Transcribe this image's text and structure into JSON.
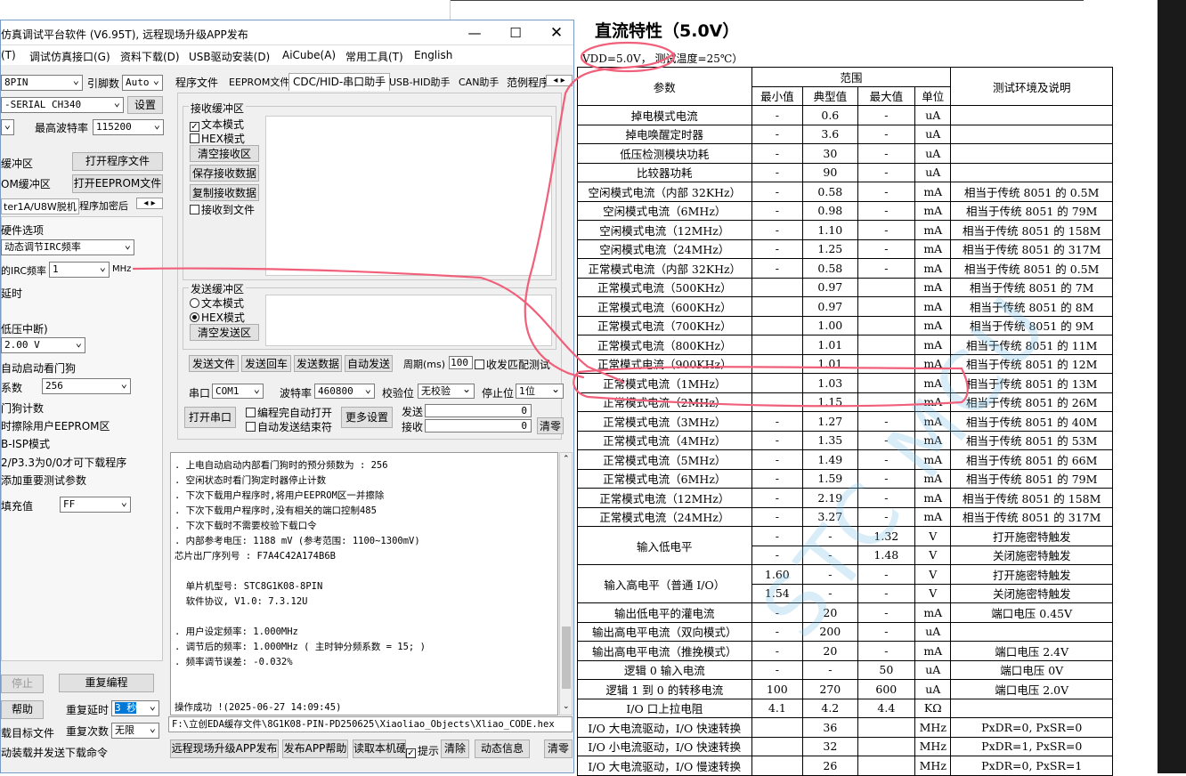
{
  "app": {
    "title": "仿真调试平台软件 (V6.95T), 远程现场升级APP发布",
    "menu": [
      "(T)",
      "调试仿真接口(G)",
      "资料下载(D)",
      "USB驱动安装(D)",
      "AiCube(A)",
      "常用工具(T)",
      "English"
    ]
  },
  "left": {
    "pin": "8PIN",
    "pin_count_label": "引脚数",
    "pin_count_value": "Auto",
    "port": "-SERIAL CH340",
    "settings": "设置",
    "max_baud_label": "最高波特率",
    "max_baud": "115200",
    "buf1": "缓冲区",
    "buf2": "OM缓冲区",
    "open_prog": "打开程序文件",
    "open_eeprom": "打开EEPROM文件",
    "tab1": "ter1A/U8W脱机",
    "tab2": "程序加密后",
    "hw_title": "硬件选项",
    "irc_mode": "动态调节IRC频率",
    "irc_label": "的IRC频率",
    "irc_value": "1",
    "mhz": "MHz",
    "delay": "延时",
    "lvd": "低压中断)",
    "voltage": "2.00 V",
    "wdt": "自动启动看门狗",
    "div_label": "系数",
    "div_value": "256",
    "wdt_count": "门狗计数",
    "erase": "时擦除用户EEPROM区",
    "isp": "B-ISP模式",
    "p32": "2/P3.3为0/0才可下载程序",
    "addparam": "添加重要测试参数",
    "fill_label": "填充值",
    "fill_value": "FF",
    "stop": "停止",
    "reprogram": "重复编程",
    "help": "帮助",
    "repeat_delay": "重复延时",
    "repeat_delay_value": "3 秒",
    "repeat_count": "重复次数",
    "repeat_count_value": "无限",
    "target": "载目标文件",
    "autodl": "动装载并发送下载命令"
  },
  "tabs": [
    "程序文件",
    "EEPROM文件",
    "CDC/HID-串口助手",
    "USB-HID助手",
    "CAN助手",
    "范例程序"
  ],
  "rx": {
    "title": "接收缓冲区",
    "text_mode": "文本模式",
    "hex_mode": "HEX模式",
    "clear": "清空接收区",
    "save": "保存接收数据",
    "copy": "复制接收数据",
    "to_file": "接收到文件"
  },
  "tx": {
    "title": "发送缓冲区",
    "text_mode": "文本模式",
    "hex_mode": "HEX模式",
    "clear": "清空发送区"
  },
  "send_row": {
    "send_file": "发送文件",
    "send_cr": "发送回车",
    "send_data": "发送数据",
    "auto_send": "自动发送",
    "period_label": "周期(ms)",
    "period": "100",
    "match": "收发匹配测试"
  },
  "serial": {
    "port_label": "串口",
    "port": "COM1",
    "baud_label": "波特率",
    "baud": "460800",
    "parity_label": "校验位",
    "parity": "无校验",
    "stop_label": "停止位",
    "stop": "1位",
    "open": "打开串口",
    "auto_open": "编程完自动打开",
    "auto_end": "自动发送结束符",
    "more": "更多设置",
    "sent_label": "发送",
    "sent": "0",
    "recv_label": "接收",
    "recv": "0",
    "clear": "清零"
  },
  "log": [
    ". 上电自动启动内部看门狗时的预分频数为 : 256",
    ". 空闲状态时看门狗定时器停止计数",
    ". 下次下载用户程序时,将用户EEPROM区一并擦除",
    ". 下次下载用户程序时,没有相关的端口控制485",
    ". 下次下载时不需要校验下载口令",
    ". 内部参考电压: 1188 mV (参考范围: 1100~1300mV)",
    "芯片出厂序列号 : F7A4C42A174B6B",
    "",
    "  单片机型号: STC8G1K08-8PIN",
    "  软件协议, V1.0: 7.3.12U",
    "",
    ". 用户设定频率: 1.000MHz",
    ". 调节后的频率: 1.000MHz ( 主时钟分频系数 = 15; )",
    ". 频率调节误差: -0.032%",
    "",
    "",
    "操作成功 !(2025-06-27 14:09:45)"
  ],
  "path": "F:\\立创EDA缓存文件\\8G1K08-PIN-PD250625\\Xiaoliao_Objects\\Xliao_CODE.hex",
  "bottom": {
    "publish": "远程现场升级APP发布",
    "help": "发布APP帮助",
    "read": "读取本机硬",
    "hint": "提示",
    "clear": "清除",
    "dyn": "动态信息",
    "zero": "清零"
  },
  "doc": {
    "title": "直流特性（5.0V）",
    "cond_vdd": "VDD=5.0V，",
    "cond_temp": "测试温度=25℃）",
    "head": {
      "param": "参数",
      "range": "范围",
      "min": "最小值",
      "typ": "典型值",
      "max": "最大值",
      "unit": "单位",
      "env": "测试环境及说明"
    },
    "rows": [
      [
        "掉电模式电流",
        "-",
        "0.6",
        "-",
        "uA",
        ""
      ],
      [
        "掉电唤醒定时器",
        "-",
        "3.6",
        "-",
        "uA",
        ""
      ],
      [
        "低压检测模块功耗",
        "-",
        "30",
        "-",
        "uA",
        ""
      ],
      [
        "比较器功耗",
        "-",
        "90",
        "-",
        "uA",
        ""
      ],
      [
        "空闲模式电流（内部 32KHz）",
        "-",
        "0.58",
        "-",
        "mA",
        "相当于传统 8051 的 0.5M"
      ],
      [
        "空闲模式电流（6MHz）",
        "-",
        "0.98",
        "-",
        "mA",
        "相当于传统 8051 的 79M"
      ],
      [
        "空闲模式电流（12MHz）",
        "-",
        "1.10",
        "-",
        "mA",
        "相当于传统 8051 的 158M"
      ],
      [
        "空闲模式电流（24MHz）",
        "-",
        "1.25",
        "-",
        "mA",
        "相当于传统 8051 的 317M"
      ],
      [
        "正常模式电流（内部 32KHz）",
        "-",
        "0.58",
        "-",
        "mA",
        "相当于传统 8051 的 0.5M"
      ],
      [
        "正常模式电流（500KHz）",
        "",
        "0.97",
        "",
        "mA",
        "相当于传统 8051 的 7M"
      ],
      [
        "正常模式电流（600KHz）",
        "",
        "0.97",
        "",
        "mA",
        "相当于传统 8051 的 8M"
      ],
      [
        "正常模式电流（700KHz）",
        "",
        "1.00",
        "",
        "mA",
        "相当于传统 8051 的 9M"
      ],
      [
        "正常模式电流（800KHz）",
        "",
        "1.01",
        "",
        "mA",
        "相当于传统 8051 的 11M"
      ],
      [
        "正常模式电流（900KHz）",
        "",
        "1.01",
        "",
        "mA",
        "相当于传统 8051 的 12M"
      ],
      [
        "正常模式电流（1MHz）",
        "",
        "1.03",
        "",
        "mA",
        "相当于传统 8051 的 13M"
      ],
      [
        "正常模式电流（2MHz）",
        "",
        "1.15",
        "",
        "mA",
        "相当于传统 8051 的 26M"
      ],
      [
        "正常模式电流（3MHz）",
        "-",
        "1.27",
        "-",
        "mA",
        "相当于传统 8051 的 40M"
      ],
      [
        "正常模式电流（4MHz）",
        "-",
        "1.35",
        "-",
        "mA",
        "相当于传统 8051 的 53M"
      ],
      [
        "正常模式电流（5MHz）",
        "-",
        "1.49",
        "-",
        "mA",
        "相当于传统 8051 的 66M"
      ],
      [
        "正常模式电流（6MHz）",
        "-",
        "1.59",
        "-",
        "mA",
        "相当于传统 8051 的 79M"
      ],
      [
        "正常模式电流（12MHz）",
        "-",
        "2.19",
        "-",
        "mA",
        "相当于传统 8051 的 158M"
      ],
      [
        "正常模式电流（24MHz）",
        "-",
        "3.27",
        "-",
        "mA",
        "相当于传统 8051 的 317M"
      ]
    ],
    "vil": {
      "label": "输入低电平",
      "r1": [
        "-",
        "-",
        "1.32",
        "V",
        "打开施密特触发"
      ],
      "r2": [
        "-",
        "-",
        "1.48",
        "V",
        "关闭施密特触发"
      ]
    },
    "vih": {
      "label": "输入高电平（普通 I/O）",
      "r1": [
        "1.60",
        "-",
        "-",
        "V",
        "打开施密特触发"
      ],
      "r2": [
        "1.54",
        "-",
        "-",
        "V",
        "关闭施密特触发"
      ]
    },
    "rows2": [
      [
        "输出低电平的灌电流",
        "-",
        "20",
        "-",
        "mA",
        "端口电压 0.45V"
      ],
      [
        "输出高电平电流（双向模式）",
        "-",
        "200",
        "-",
        "uA",
        ""
      ],
      [
        "输出高电平电流（推挽模式）",
        "-",
        "20",
        "-",
        "mA",
        "端口电压 2.4V"
      ],
      [
        "逻辑 0 输入电流",
        "-",
        "-",
        "50",
        "uA",
        "端口电压 0V"
      ],
      [
        "逻辑 1 到 0 的转移电流",
        "100",
        "270",
        "600",
        "uA",
        "端口电压 2.0V"
      ],
      [
        "I/O 口上拉电阻",
        "4.1",
        "4.2",
        "4.4",
        "KΩ",
        ""
      ],
      [
        "I/O 大电流驱动，I/O 快速转换",
        "",
        "36",
        "",
        "MHz",
        "PxDR=0, PxSR=0"
      ],
      [
        "I/O 小电流驱动，I/O 快速转换",
        "",
        "32",
        "",
        "MHz",
        "PxDR=1, PxSR=0"
      ],
      [
        "I/O 大电流驱动，I/O 慢速转换",
        "",
        "26",
        "",
        "MHz",
        "PxDR=0, PxSR=1"
      ]
    ],
    "watermark": "STC MCU"
  }
}
